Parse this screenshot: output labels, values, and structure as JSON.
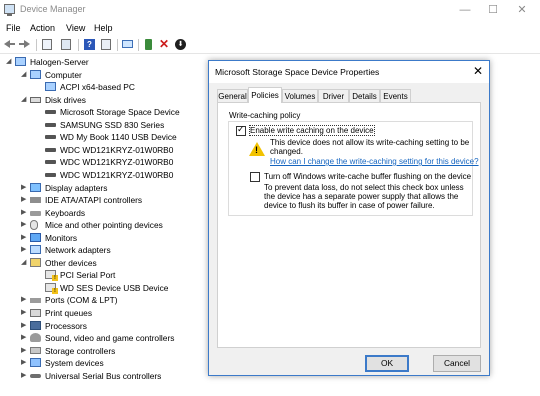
{
  "window": {
    "title": "Device Manager",
    "controls": {
      "minimize": "—",
      "maximize": "☐",
      "close": "✕"
    }
  },
  "menubar": {
    "items": [
      "File",
      "Action",
      "View",
      "Help"
    ]
  },
  "toolbar": {
    "buttons": [
      {
        "name": "back-button",
        "icon": "arrow-left-icon"
      },
      {
        "name": "forward-button",
        "icon": "arrow-right-icon"
      },
      {
        "name": "show-hide-console-tree-button",
        "icon": "console-tree-icon"
      },
      {
        "name": "properties-button",
        "icon": "properties-icon"
      },
      {
        "name": "help-button",
        "icon": "help-icon",
        "glyph": "?"
      },
      {
        "name": "show-action-pane-button",
        "icon": "action-pane-icon"
      },
      {
        "name": "scan-hardware-button",
        "icon": "monitor-icon"
      },
      {
        "name": "update-driver-button",
        "icon": "update-driver-icon"
      },
      {
        "name": "uninstall-button",
        "icon": "red-x-icon",
        "glyph": "✕"
      },
      {
        "name": "disable-button",
        "icon": "download-icon",
        "glyph": "⬇"
      }
    ]
  },
  "tree": {
    "expand_glyph": "▶",
    "collapse_glyph": "◢",
    "nodes": [
      {
        "label": "Halogen-Server",
        "level": 0,
        "state": "expanded",
        "icon": "computer-root-icon"
      },
      {
        "label": "Computer",
        "level": 1,
        "state": "expanded",
        "icon": "computer-icon"
      },
      {
        "label": "ACPI x64-based PC",
        "level": 2,
        "state": "leaf",
        "icon": "computer-icon"
      },
      {
        "label": "Disk drives",
        "level": 1,
        "state": "expanded",
        "icon": "disk-icon"
      },
      {
        "label": "Microsoft Storage Space Device",
        "level": 2,
        "state": "leaf",
        "icon": "drive-icon"
      },
      {
        "label": "SAMSUNG SSD 830 Series",
        "level": 2,
        "state": "leaf",
        "icon": "drive-icon"
      },
      {
        "label": "WD My Book 1140 USB Device",
        "level": 2,
        "state": "leaf",
        "icon": "drive-icon"
      },
      {
        "label": "WDC WD121KRYZ-01W0RB0",
        "level": 2,
        "state": "leaf",
        "icon": "drive-icon"
      },
      {
        "label": "WDC WD121KRYZ-01W0RB0",
        "level": 2,
        "state": "leaf",
        "icon": "drive-icon"
      },
      {
        "label": "WDC WD121KRYZ-01W0RB0",
        "level": 2,
        "state": "leaf",
        "icon": "drive-icon"
      },
      {
        "label": "Display adapters",
        "level": 1,
        "state": "collapsed",
        "icon": "display-icon"
      },
      {
        "label": "IDE ATA/ATAPI controllers",
        "level": 1,
        "state": "collapsed",
        "icon": "ide-icon"
      },
      {
        "label": "Keyboards",
        "level": 1,
        "state": "collapsed",
        "icon": "keyboard-icon"
      },
      {
        "label": "Mice and other pointing devices",
        "level": 1,
        "state": "collapsed",
        "icon": "mouse-icon"
      },
      {
        "label": "Monitors",
        "level": 1,
        "state": "collapsed",
        "icon": "monitor-icon"
      },
      {
        "label": "Network adapters",
        "level": 1,
        "state": "collapsed",
        "icon": "network-icon"
      },
      {
        "label": "Other devices",
        "level": 1,
        "state": "expanded",
        "icon": "other-devices-icon"
      },
      {
        "label": "PCI Serial Port",
        "level": 2,
        "state": "leaf",
        "icon": "pci-warning-icon"
      },
      {
        "label": "WD SES Device USB Device",
        "level": 2,
        "state": "leaf",
        "icon": "pci-warning-icon"
      },
      {
        "label": "Ports (COM & LPT)",
        "level": 1,
        "state": "collapsed",
        "icon": "port-icon"
      },
      {
        "label": "Print queues",
        "level": 1,
        "state": "collapsed",
        "icon": "printer-icon"
      },
      {
        "label": "Processors",
        "level": 1,
        "state": "collapsed",
        "icon": "cpu-icon"
      },
      {
        "label": "Sound, video and game controllers",
        "level": 1,
        "state": "collapsed",
        "icon": "sound-icon"
      },
      {
        "label": "Storage controllers",
        "level": 1,
        "state": "collapsed",
        "icon": "storage-icon"
      },
      {
        "label": "System devices",
        "level": 1,
        "state": "collapsed",
        "icon": "system-icon"
      },
      {
        "label": "Universal Serial Bus controllers",
        "level": 1,
        "state": "collapsed",
        "icon": "usb-icon"
      }
    ]
  },
  "dialog": {
    "title": "Microsoft Storage Space Device Properties",
    "close_glyph": "✕",
    "tabs": [
      {
        "label": "General",
        "active": false
      },
      {
        "label": "Policies",
        "active": true
      },
      {
        "label": "Volumes",
        "active": false
      },
      {
        "label": "Driver",
        "active": false
      },
      {
        "label": "Details",
        "active": false
      },
      {
        "label": "Events",
        "active": false
      }
    ],
    "write_caching": {
      "group_label": "Write-caching policy",
      "enable_label": "Enable write caching on the device",
      "enable_checked": true,
      "warning_text": "This device does not allow its write-caching setting to be changed.",
      "help_link": "How can I change the write-caching setting for this device?",
      "flush_label": "Turn off Windows write-cache buffer flushing on the device",
      "flush_checked": false,
      "flush_text": "To prevent data loss, do not select this check box unless the device has a separate power supply that allows the device to flush its buffer in case of power failure."
    },
    "buttons": {
      "ok": "OK",
      "cancel": "Cancel"
    },
    "colors": {
      "accent": "#3c7ac9",
      "link": "#1565c0",
      "warning": "#f2c200"
    }
  }
}
